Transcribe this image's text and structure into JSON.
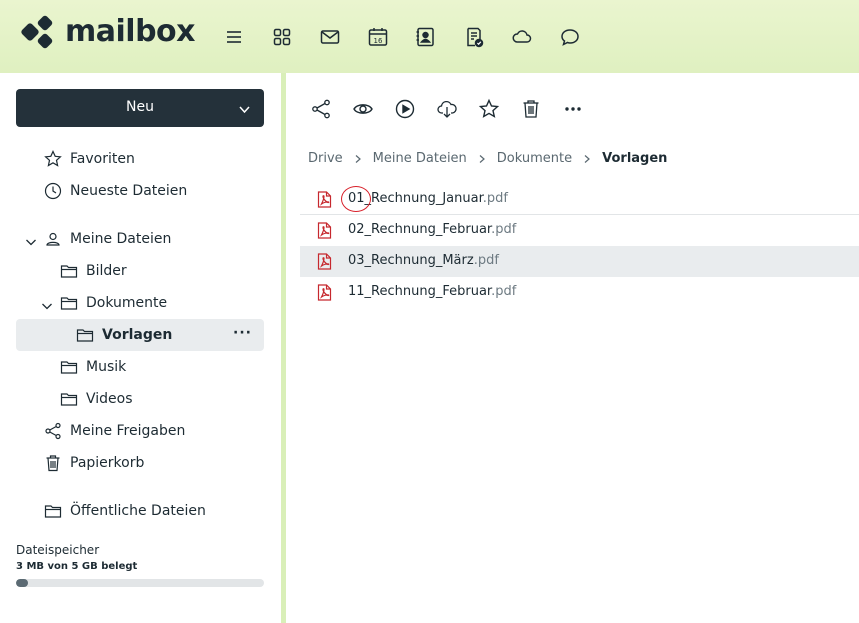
{
  "header": {
    "logo_text": "mailbox",
    "apps": [
      {
        "icon": "menu-icon"
      },
      {
        "icon": "apps-grid-icon"
      },
      {
        "icon": "mail-icon"
      },
      {
        "icon": "calendar-icon",
        "badge": "16"
      },
      {
        "icon": "contacts-icon"
      },
      {
        "icon": "tasks-icon"
      },
      {
        "icon": "cloud-icon"
      },
      {
        "icon": "chat-icon"
      }
    ]
  },
  "sidebar": {
    "new_button": "Neu",
    "items": [
      {
        "label": "Favoriten",
        "icon": "star-icon"
      },
      {
        "label": "Neueste Dateien",
        "icon": "clock-icon"
      },
      {
        "label": "Meine Dateien",
        "icon": "user-icon"
      },
      {
        "label": "Bilder",
        "icon": "folder-icon"
      },
      {
        "label": "Dokumente",
        "icon": "folder-icon"
      },
      {
        "label": "Vorlagen",
        "icon": "folder-icon",
        "more": "···"
      },
      {
        "label": "Musik",
        "icon": "folder-icon"
      },
      {
        "label": "Videos",
        "icon": "folder-icon"
      },
      {
        "label": "Meine Freigaben",
        "icon": "share-icon"
      },
      {
        "label": "Papierkorb",
        "icon": "trash-icon"
      },
      {
        "label": "Öffentliche Dateien",
        "icon": "folder-icon"
      }
    ],
    "storage": {
      "title": "Dateispeicher",
      "usage": "3 MB von 5 GB belegt",
      "fraction": 0.05
    }
  },
  "toolbar": {
    "icons": [
      "share-icon",
      "preview-eye-icon",
      "play-icon",
      "cloud-download-icon",
      "star-icon",
      "trash-icon",
      "more-icon"
    ]
  },
  "breadcrumb": [
    "Drive",
    "Meine Dateien",
    "Dokumente",
    "Vorlagen"
  ],
  "files": [
    {
      "name": "01_Rechnung_Januar",
      "ext": ".pdf"
    },
    {
      "name": "02_Rechnung_Februar",
      "ext": ".pdf"
    },
    {
      "name": "03_Rechnung_März",
      "ext": ".pdf"
    },
    {
      "name": "11_Rechnung_Februar",
      "ext": ".pdf"
    }
  ],
  "colors": {
    "header_bg": "#dff0c0",
    "dark": "#24313a",
    "pdf_red": "#c6282e",
    "annotation": "#d8202a"
  }
}
